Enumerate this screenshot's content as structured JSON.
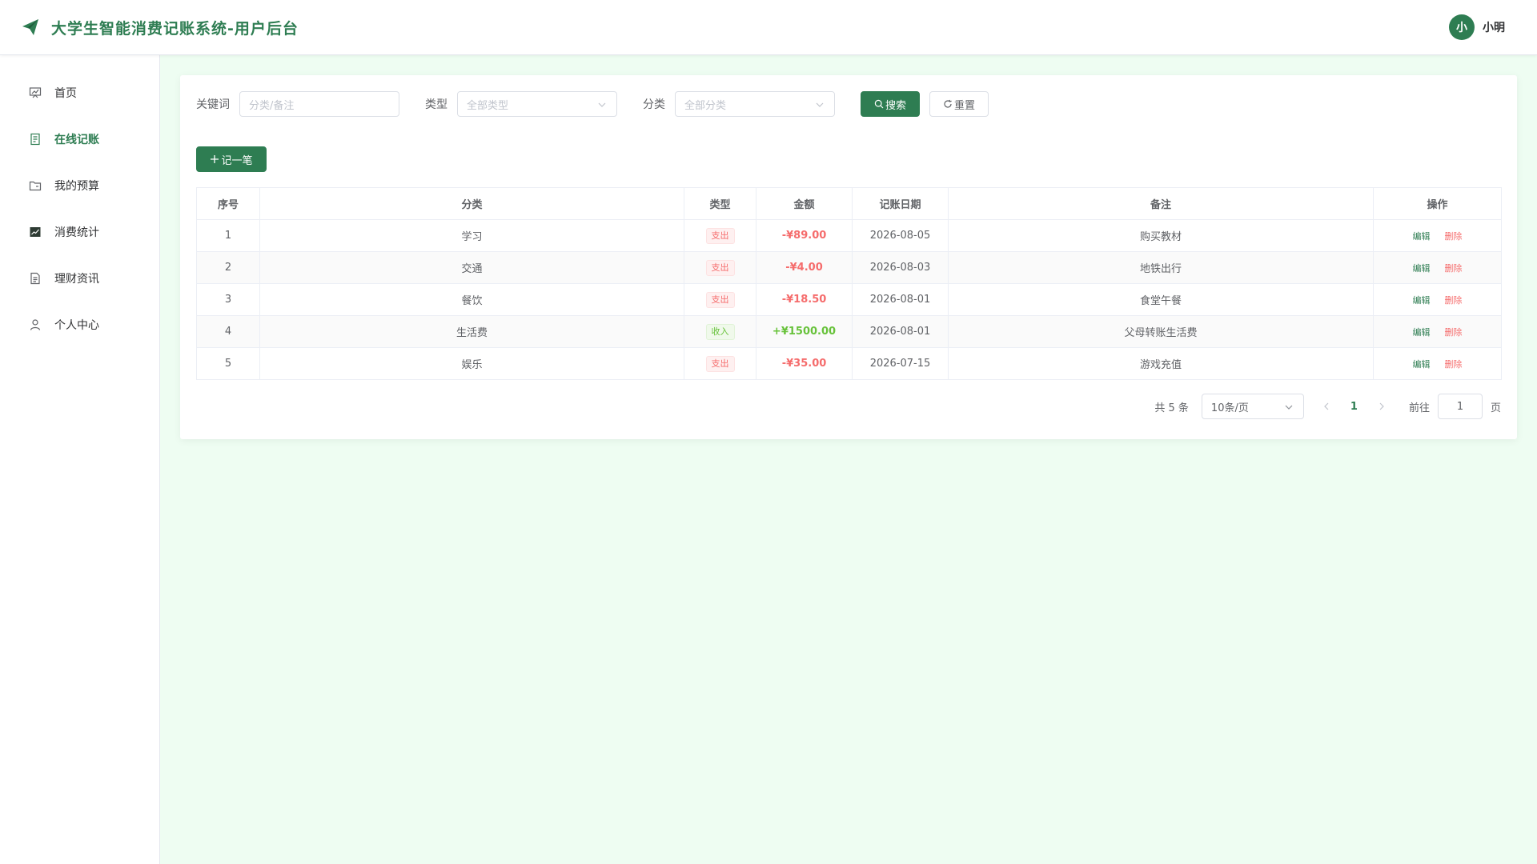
{
  "header": {
    "title": "大学生智能消费记账系统-用户后台",
    "avatar_text": "小",
    "username": "小明"
  },
  "sidebar": {
    "items": [
      {
        "label": "首页",
        "icon": "dashboard-icon"
      },
      {
        "label": "在线记账",
        "icon": "document-icon",
        "active": true
      },
      {
        "label": "我的预算",
        "icon": "folder-icon"
      },
      {
        "label": "消费统计",
        "icon": "chart-icon"
      },
      {
        "label": "理财资讯",
        "icon": "news-icon"
      },
      {
        "label": "个人中心",
        "icon": "user-icon"
      }
    ]
  },
  "filters": {
    "keyword_label": "关键词",
    "keyword_placeholder": "分类/备注",
    "type_label": "类型",
    "type_placeholder": "全部类型",
    "category_label": "分类",
    "category_placeholder": "全部分类",
    "search_label": "搜索",
    "reset_label": "重置"
  },
  "add_button_label": "记一笔",
  "table": {
    "columns": [
      "序号",
      "分类",
      "类型",
      "金额",
      "记账日期",
      "备注",
      "操作"
    ],
    "rows": [
      {
        "index": "1",
        "category": "学习",
        "type": "支出",
        "amount": "-¥89.00",
        "date": "2026-08-05",
        "note": "购买教材"
      },
      {
        "index": "2",
        "category": "交通",
        "type": "支出",
        "amount": "-¥4.00",
        "date": "2026-08-03",
        "note": "地铁出行"
      },
      {
        "index": "3",
        "category": "餐饮",
        "type": "支出",
        "amount": "-¥18.50",
        "date": "2026-08-01",
        "note": "食堂午餐"
      },
      {
        "index": "4",
        "category": "生活费",
        "type": "收入",
        "amount": "+¥1500.00",
        "date": "2026-08-01",
        "note": "父母转账生活费"
      },
      {
        "index": "5",
        "category": "娱乐",
        "type": "支出",
        "amount": "-¥35.00",
        "date": "2026-07-15",
        "note": "游戏充值"
      }
    ],
    "edit_label": "编辑",
    "delete_label": "删除"
  },
  "pagination": {
    "total_text": "共 5 条",
    "page_size": "10条/页",
    "current_page": "1",
    "goto_label": "前往",
    "goto_value": "1",
    "page_suffix": "页"
  },
  "colors": {
    "primary": "#2e7d52",
    "expense": "#f56c6c",
    "income": "#67c23a",
    "main_bg": "#eefdf2"
  }
}
